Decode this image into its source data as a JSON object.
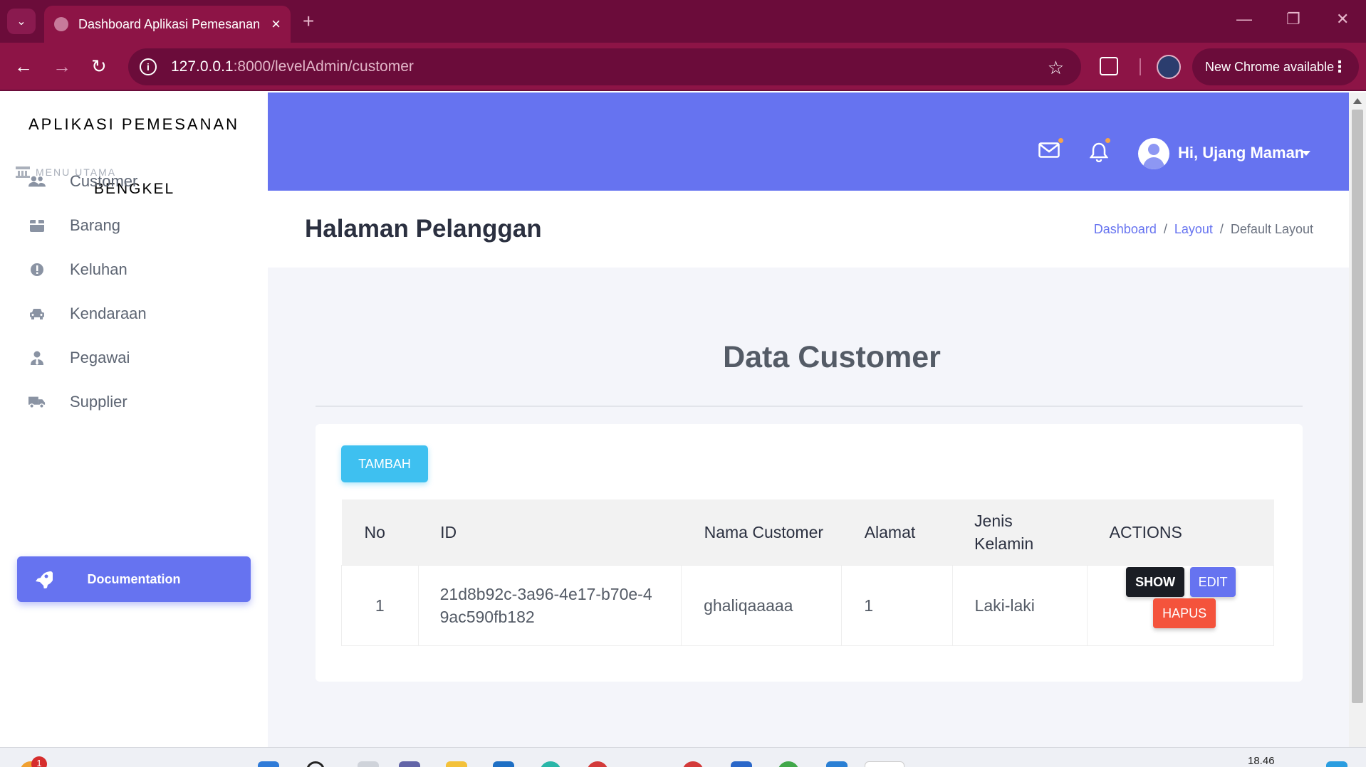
{
  "browser": {
    "tab_title": "Dashboard Aplikasi Pemesanan",
    "url_host": "127.0.0.1",
    "url_path": ":8000/levelAdmin/customer",
    "update_button": "New Chrome available",
    "theme_color": "#8d1446"
  },
  "sidebar": {
    "brand": "APLIKASI PEMESANAN",
    "menu_caption": "MENU UTAMA",
    "brand_sub": "BENGKEL",
    "items": [
      {
        "label": "Customer",
        "icon": "users-icon"
      },
      {
        "label": "Barang",
        "icon": "box-icon"
      },
      {
        "label": "Keluhan",
        "icon": "alert-circle-icon"
      },
      {
        "label": "Kendaraan",
        "icon": "car-icon"
      },
      {
        "label": "Pegawai",
        "icon": "user-tie-icon"
      },
      {
        "label": "Supplier",
        "icon": "truck-icon"
      }
    ],
    "documentation_label": "Documentation"
  },
  "header": {
    "greeting": "Hi, Ujang Maman",
    "accent": "#6673f0"
  },
  "page": {
    "title": "Halaman Pelanggan",
    "breadcrumb": [
      "Dashboard",
      "Layout",
      "Default Layout"
    ],
    "section_title": "Data Customer",
    "add_button": "TAMBAH"
  },
  "table": {
    "columns": [
      "No",
      "ID",
      "Nama Customer",
      "Alamat",
      "Jenis Kelamin",
      "ACTIONS"
    ],
    "rows": [
      {
        "no": "1",
        "id": "21d8b92c-3a96-4e17-b70e-49ac590fb182",
        "nama": "ghaliqaaaaa",
        "alamat": "1",
        "jenis_kelamin": "Laki-laki",
        "actions": {
          "show": "SHOW",
          "edit": "EDIT",
          "hapus": "HAPUS"
        }
      }
    ]
  },
  "taskbar": {
    "notification_count": "1",
    "clock": "18.46"
  }
}
